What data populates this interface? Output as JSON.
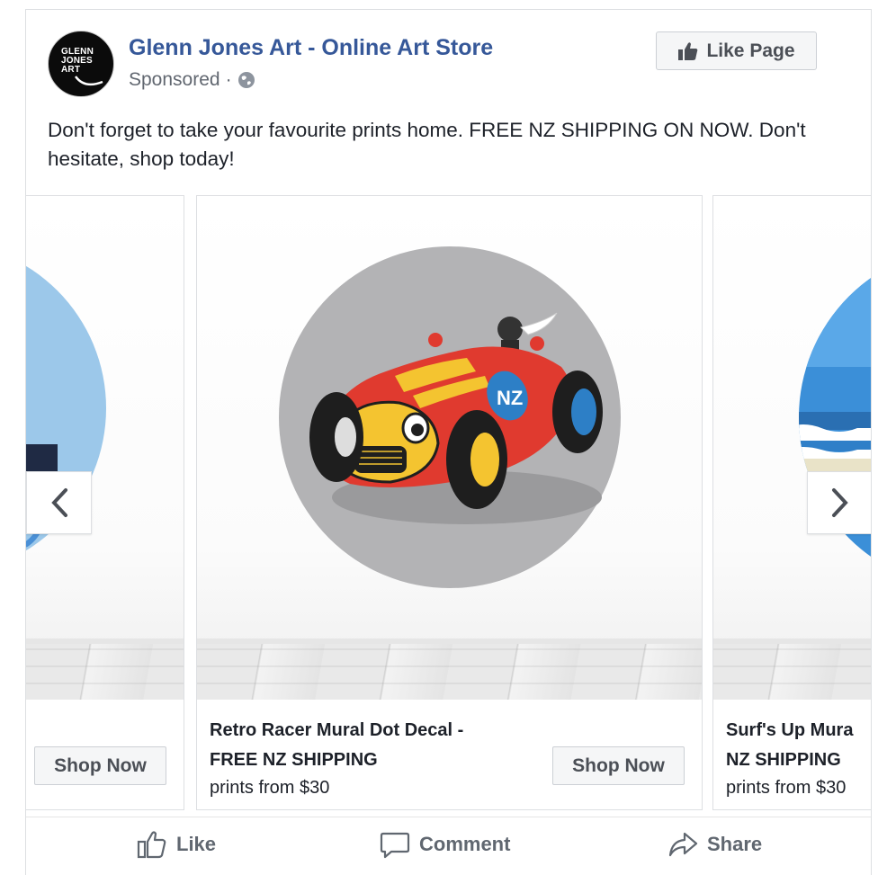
{
  "page": {
    "name": "Glenn Jones Art - Online Art Store",
    "avatar_text": [
      "GLENN",
      "JONES",
      "ART"
    ],
    "sponsored": "Sponsored",
    "separator": "·",
    "like_page_label": "Like Page"
  },
  "post": {
    "text": "Don't forget to take your favourite prints home. FREE NZ SHIPPING ON NOW. Don't hesitate, shop today!"
  },
  "carousel": {
    "cards": [
      {
        "title_line1": "",
        "title_line2": "",
        "price": "",
        "cta": "Shop Now"
      },
      {
        "title_line1": "Retro Racer Mural Dot Decal -",
        "title_line2": "FREE NZ SHIPPING",
        "price": "prints from $30",
        "cta": "Shop Now",
        "badge": "NZ"
      },
      {
        "title_line1": "Surf's Up Mura",
        "title_line2": "NZ SHIPPING",
        "price": "prints from $30",
        "cta": ""
      }
    ],
    "prev_icon": "chevron-left-icon",
    "next_icon": "chevron-right-icon"
  },
  "actions": {
    "like": "Like",
    "comment": "Comment",
    "share": "Share"
  },
  "colors": {
    "link": "#365899",
    "text": "#1d2129",
    "muted": "#616770",
    "button_bg": "#f5f6f7",
    "button_border": "#ccd0d5"
  }
}
